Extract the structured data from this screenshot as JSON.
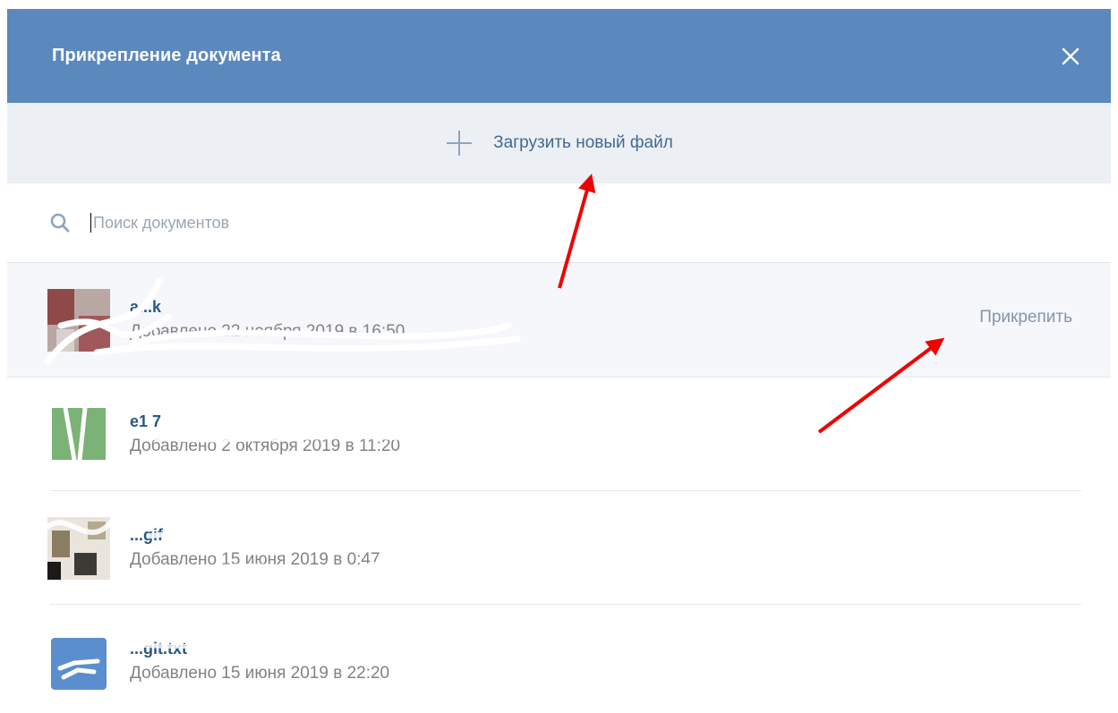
{
  "modal": {
    "title": "Прикрепление документа",
    "close_icon": "close-icon"
  },
  "upload": {
    "label": "Загрузить новый файл",
    "icon": "plus-icon"
  },
  "search": {
    "placeholder": "Поиск документов",
    "value": "",
    "icon": "search-icon"
  },
  "documents": [
    {
      "name": "a...k",
      "date": "Добавлено 22 ноября 2019 в 16:50",
      "action": "Прикрепить"
    },
    {
      "name": "e1 7",
      "date": "Добавлено 2 октября 2019 в 11:20"
    },
    {
      "name": "...gif",
      "date": "Добавлено 15 июня 2019 в 0:47"
    },
    {
      "name": "...git.txt",
      "date": "Добавлено 15 июня 2019 в 22:20"
    }
  ],
  "colors": {
    "header": "#5b88bd",
    "upload_bg": "#ecf0f5",
    "link": "#45688e",
    "annotation_arrow": "#f00000"
  }
}
